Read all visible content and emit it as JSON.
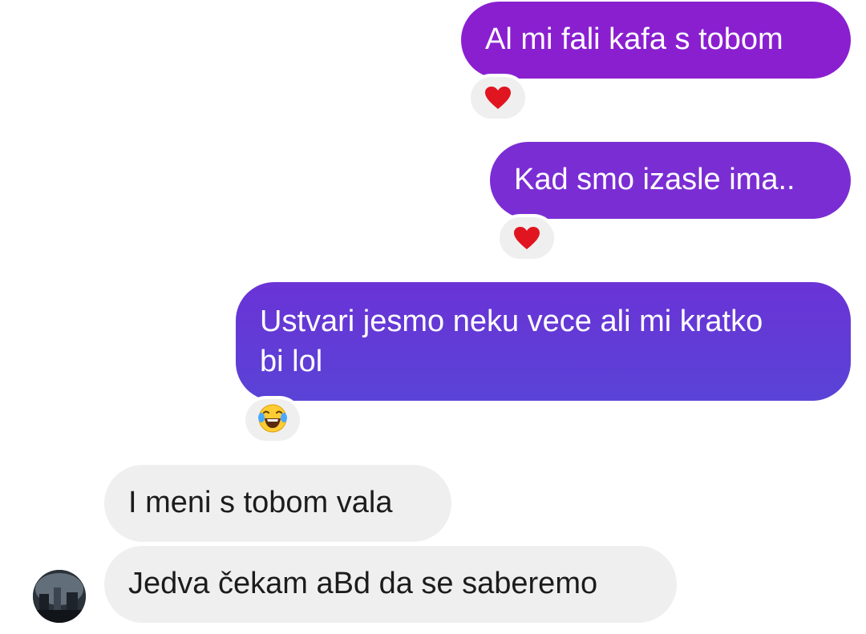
{
  "thread": {
    "messages": [
      {
        "side": "sent",
        "text": "Al mi fali kafa s tobom",
        "reaction": "heart-icon"
      },
      {
        "side": "sent",
        "text": "Kad smo izasle ima..",
        "reaction": "heart-icon"
      },
      {
        "side": "sent",
        "text_line1": "Ustvari jesmo neku vece ali mi kratko",
        "text_line2": "bi lol",
        "reaction": "laughing-tears-icon"
      },
      {
        "side": "received",
        "text": "I meni s tobom vala"
      },
      {
        "side": "received",
        "text": "Jedva čekam aBd da se saberemo"
      }
    ]
  },
  "colors": {
    "sent_gradient_top": "#8a1fd0",
    "sent_gradient_bottom": "#5a43d6",
    "received_bg": "#efefef",
    "heart": "#e0151f"
  }
}
